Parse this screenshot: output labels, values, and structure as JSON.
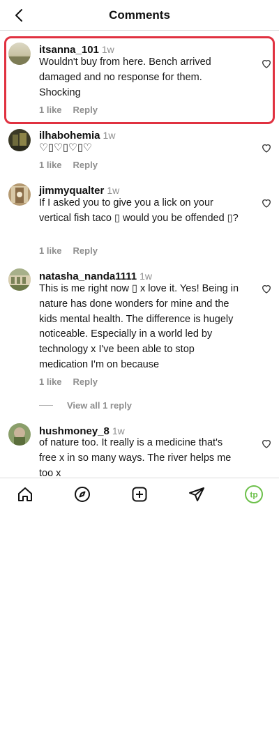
{
  "header": {
    "title": "Comments"
  },
  "comments": [
    {
      "username": "itsanna_101",
      "time": "1w",
      "text": "Wouldn't buy from here. Bench arrived damaged and no response for them. Shocking",
      "likes": "1 like",
      "reply": "Reply"
    },
    {
      "username": "ilhabohemia",
      "time": "1w",
      "text": "♡▯♡▯♡▯♡",
      "likes": "1 like",
      "reply": "Reply"
    },
    {
      "username": "jimmyqualter",
      "time": "1w",
      "text": "If I asked you to give you a lick on your vertical fish taco ▯ would you be offended ▯?",
      "likes": "1 like",
      "reply": "Reply"
    },
    {
      "username": "natasha_nanda1111",
      "time": "1w",
      "text": "This is me right now ▯ x love it. Yes! Being in nature has done wonders for mine and the kids mental health. The difference is hugely noticeable. Especially in a world led by technology x I've been able to stop medication I'm on because",
      "likes": "1 like",
      "reply": "Reply",
      "view_replies": "View all 1 reply"
    },
    {
      "username": "hushmoney_8",
      "time": "1w",
      "text": "of nature too. It really is a medicine that's free x in so many ways. The river helps me too x"
    }
  ],
  "colors": {
    "highlight": "#e03140",
    "accent_avatar": "#6cc04a",
    "muted": "#8e8e8e"
  },
  "nav": {
    "icons": [
      "home-icon",
      "explore-icon",
      "create-icon",
      "direct-icon",
      "profile-avatar"
    ],
    "profile_initials": "tp"
  }
}
